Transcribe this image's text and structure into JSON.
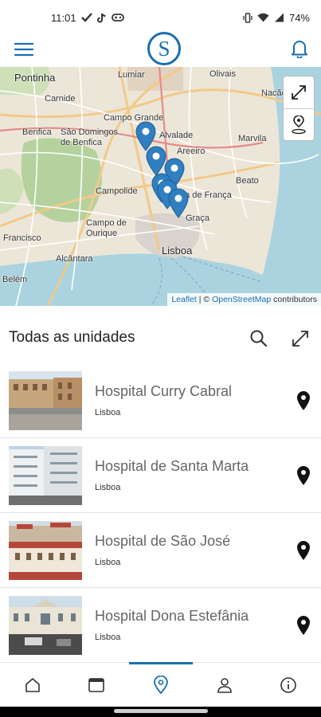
{
  "status_bar": {
    "time": "11:01",
    "battery": "74%"
  },
  "header": {
    "logo_letter": "S",
    "brand_color": "#1a6fb0"
  },
  "map": {
    "labels": [
      "Pontinha",
      "Lumiar",
      "Olivais",
      "Carnide",
      "Nacão",
      "Campo Grande",
      "Benfica",
      "São Domingos de Benfica",
      "Alvalade",
      "Marvila",
      "Areeiro",
      "Campolide",
      "Beato",
      "Campo de Ourique",
      "da de França",
      "Graça",
      "Francisco",
      "Alcântara",
      "Lisboa",
      "Belém"
    ],
    "attribution_leaflet": "Leaflet",
    "attribution_separator": " | © ",
    "attribution_osm": "OpenStreetMap",
    "attribution_suffix": " contributors"
  },
  "section": {
    "title": "Todas as unidades"
  },
  "hospitals": [
    {
      "name": "Hospital Curry Cabral",
      "city": "Lisboa"
    },
    {
      "name": "Hospital de Santa Marta",
      "city": "Lisboa"
    },
    {
      "name": "Hospital de São José",
      "city": "Lisboa"
    },
    {
      "name": "Hospital Dona Estefânia",
      "city": "Lisboa"
    }
  ],
  "bottom_nav": {
    "items": [
      "home-icon",
      "calendar-card-icon",
      "location-pin-icon",
      "person-icon",
      "info-icon"
    ],
    "active": "location-pin-icon"
  }
}
